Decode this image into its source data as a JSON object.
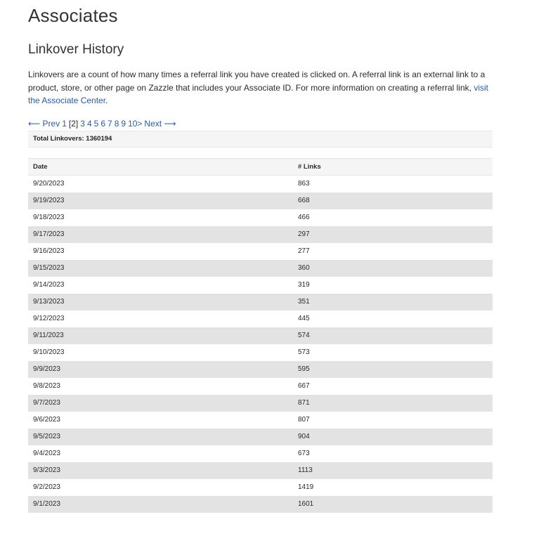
{
  "header": {
    "title": "Associates"
  },
  "section": {
    "title": "Linkover History",
    "intro": "Linkovers are a count of how many times a referral link you have created is clicked on. A referral link is an external link to a product, store, or other page on Zazzle that includes your Associate ID. For more information on creating a referral link, ",
    "intro_link": "visit the Associate Center",
    "intro_end": "."
  },
  "pager": {
    "prev": "⟵ Prev",
    "pages": [
      "1",
      "[2]",
      "3",
      "4",
      "5",
      "6",
      "7",
      "8",
      "9",
      "10>"
    ],
    "next": "Next ⟶"
  },
  "summary": {
    "total_label": "Total Linkovers: 1360194"
  },
  "table": {
    "headers": [
      "Date",
      "# Links"
    ],
    "rows": [
      [
        "9/20/2023",
        "863"
      ],
      [
        "9/19/2023",
        "668"
      ],
      [
        "9/18/2023",
        "466"
      ],
      [
        "9/17/2023",
        "297"
      ],
      [
        "9/16/2023",
        "277"
      ],
      [
        "9/15/2023",
        "360"
      ],
      [
        "9/14/2023",
        "319"
      ],
      [
        "9/13/2023",
        "351"
      ],
      [
        "9/12/2023",
        "445"
      ],
      [
        "9/11/2023",
        "574"
      ],
      [
        "9/10/2023",
        "573"
      ],
      [
        "9/9/2023",
        "595"
      ],
      [
        "9/8/2023",
        "667"
      ],
      [
        "9/7/2023",
        "871"
      ],
      [
        "9/6/2023",
        "807"
      ],
      [
        "9/5/2023",
        "904"
      ],
      [
        "9/4/2023",
        "673"
      ],
      [
        "9/3/2023",
        "1113"
      ],
      [
        "9/2/2023",
        "1419"
      ],
      [
        "9/1/2023",
        "1601"
      ]
    ]
  }
}
